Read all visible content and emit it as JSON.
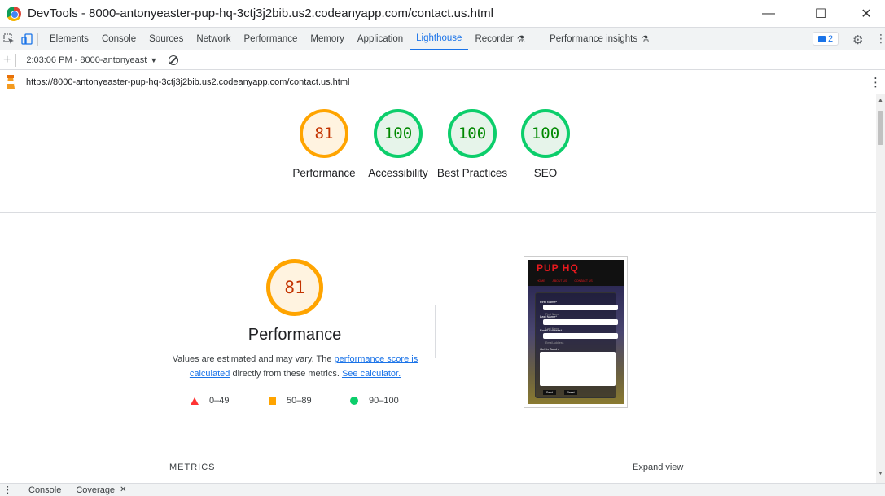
{
  "window": {
    "title": "DevTools - 8000-antonyeaster-pup-hq-3ctj3j2bib.us2.codeanyapp.com/contact.us.html",
    "minimize": "—",
    "maximize": "☐",
    "close": "✕"
  },
  "tabs": [
    "Elements",
    "Console",
    "Sources",
    "Network",
    "Performance",
    "Memory",
    "Application",
    "Lighthouse",
    "Recorder",
    "Performance insights"
  ],
  "active_tab": "Lighthouse",
  "issues_count": "2",
  "report_selector": "2:03:06 PM - 8000-antonyeast",
  "url": "https://8000-antonyeaster-pup-hq-3ctj3j2bib.us2.codeanyapp.com/contact.us.html",
  "scores": [
    {
      "value": "81",
      "label": "Performance",
      "status": "orange"
    },
    {
      "value": "100",
      "label": "Accessibility",
      "status": "green"
    },
    {
      "value": "100",
      "label": "Best Practices",
      "status": "green"
    },
    {
      "value": "100",
      "label": "SEO",
      "status": "green"
    }
  ],
  "performance": {
    "score": "81",
    "title": "Performance",
    "desc_prefix": "Values are estimated and may vary. The ",
    "link1": "performance score is calculated",
    "desc_middle": " directly from these metrics. ",
    "link2": "See calculator."
  },
  "legend": [
    {
      "range": "0–49",
      "shape": "triangle",
      "color": "#ff3333"
    },
    {
      "range": "50–89",
      "shape": "square",
      "color": "#ffa400"
    },
    {
      "range": "90–100",
      "shape": "circle",
      "color": "#0cce6b"
    }
  ],
  "preview": {
    "site_title": "PUP HQ",
    "nav": [
      "HOME",
      "ABOUT US",
      "CONTACT US"
    ],
    "fields": [
      "First Name*",
      "Last Name*",
      "Email Address*",
      "Get In Touch"
    ],
    "placeholders": [
      "First Name",
      "Last Name",
      "Email Address"
    ],
    "buttons": [
      "Send",
      "Reset"
    ]
  },
  "metrics_label": "METRICS",
  "expand_label": "Expand view",
  "drawer_tabs": [
    "Console",
    "Coverage"
  ],
  "colors": {
    "accent": "#1a73e8",
    "orange": "#ffa400",
    "green": "#0cce6b",
    "red": "#ff3333"
  }
}
